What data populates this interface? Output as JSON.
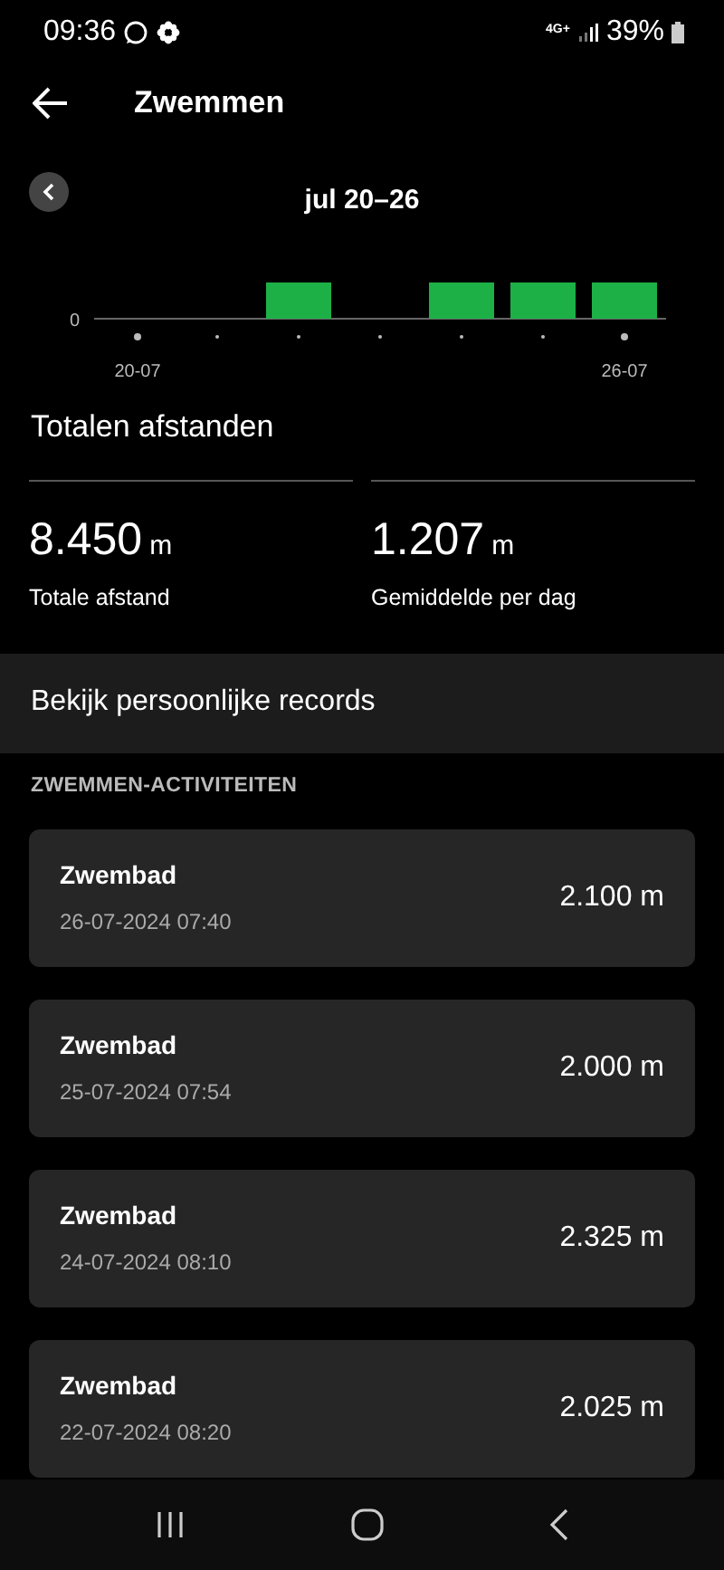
{
  "status_bar": {
    "time": "09:36",
    "network": "4G+",
    "battery": "39%"
  },
  "header": {
    "title": "Zwemmen"
  },
  "chart": {
    "range": "jul 20–26",
    "y_tick": "0",
    "x_labels": [
      "20-07",
      "26-07"
    ],
    "days": [
      {
        "active": false
      },
      {
        "active": false
      },
      {
        "active": true
      },
      {
        "active": false
      },
      {
        "active": true
      },
      {
        "active": true
      },
      {
        "active": true
      }
    ]
  },
  "totals": {
    "title": "Totalen afstanden",
    "stats": [
      {
        "value": "8.450",
        "unit": "m",
        "label": "Totale afstand"
      },
      {
        "value": "1.207",
        "unit": "m",
        "label": "Gemiddelde per dag"
      }
    ]
  },
  "records_link": "Bekijk persoonlijke records",
  "section_title": "ZWEMMEN-ACTIVITEITEN",
  "activities": [
    {
      "name": "Zwembad",
      "datetime": "26-07-2024 07:40",
      "distance": "2.100 m"
    },
    {
      "name": "Zwembad",
      "datetime": "25-07-2024 07:54",
      "distance": "2.000 m"
    },
    {
      "name": "Zwembad",
      "datetime": "24-07-2024 08:10",
      "distance": "2.325 m"
    },
    {
      "name": "Zwembad",
      "datetime": "22-07-2024 08:20",
      "distance": "2.025 m"
    }
  ]
}
